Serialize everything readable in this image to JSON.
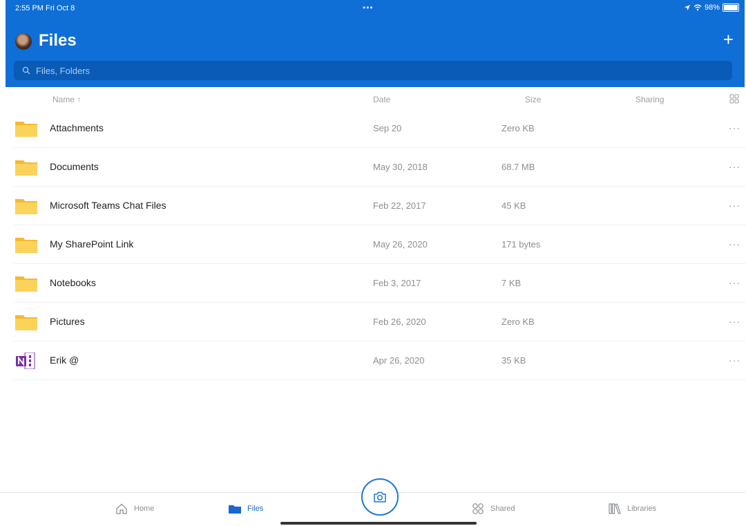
{
  "status": {
    "time": "2:55 PM  Fri Oct 8",
    "dots": "•••",
    "battery": "98%"
  },
  "header": {
    "title": "Files",
    "add": "+"
  },
  "search": {
    "placeholder": "Files, Folders"
  },
  "columns": {
    "name": "Name ↑",
    "date": "Date",
    "size": "Size",
    "sharing": "Sharing"
  },
  "files": [
    {
      "name": "Attachments",
      "date": "Sep 20",
      "size": "Zero KB",
      "type": "folder-icon",
      "more": "···"
    },
    {
      "name": "Documents",
      "date": "May 30, 2018",
      "size": "68.7 MB",
      "type": "folder-icon",
      "more": "···"
    },
    {
      "name": "Microsoft Teams Chat Files",
      "date": "Feb 22, 2017",
      "size": "45 KB",
      "type": "folder-icon",
      "more": "···"
    },
    {
      "name": "My SharePoint Link",
      "date": "May 26, 2020",
      "size": "171 bytes",
      "type": "folder-icon",
      "more": "···"
    },
    {
      "name": "Notebooks",
      "date": "Feb 3, 2017",
      "size": "7 KB",
      "type": "folder-icon",
      "more": "···"
    },
    {
      "name": "Pictures",
      "date": "Feb 26, 2020",
      "size": "Zero KB",
      "type": "folder-icon",
      "more": "···"
    },
    {
      "name": "Erik @",
      "date": "Apr 26, 2020",
      "size": "35 KB",
      "type": "onenote-icon",
      "more": "···"
    }
  ],
  "nav": {
    "home": "Home",
    "files": "Files",
    "shared": "Shared",
    "libraries": "Libraries"
  },
  "colors": {
    "header": "#0f6fd6",
    "search_bg": "#0a5bb6",
    "folder": "#f7c948",
    "onenote": "#7b2fa8",
    "accent": "#1768d1"
  }
}
